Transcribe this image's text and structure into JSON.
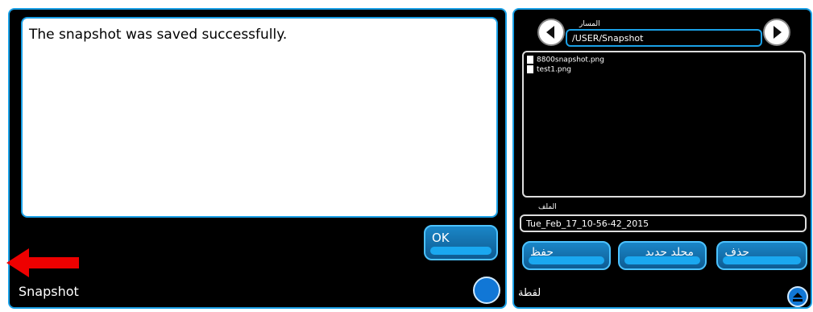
{
  "dialog": {
    "message": "The snapshot was saved successfully.",
    "ok_label": "OK",
    "title": "Snapshot"
  },
  "browser": {
    "path_label": "المسار",
    "path_value": "/USER/Snapshot",
    "files": [
      "8800snapshot.png",
      "test1.png"
    ],
    "file_label": "الملف",
    "file_value": "Tue_Feb_17_10-56-42_2015",
    "save_label": "حفظ",
    "new_folder_label": "مجلد جديد",
    "delete_label": "حذف",
    "footer_label": "لقطة"
  },
  "colors": {
    "panel_bg": "#000000",
    "accent": "#1aa0e6",
    "arrow": "#ee0000"
  },
  "icons": {
    "back": "arrow-left-icon",
    "forward": "arrow-right-icon",
    "eject": "eject-icon",
    "file": "file-icon"
  }
}
